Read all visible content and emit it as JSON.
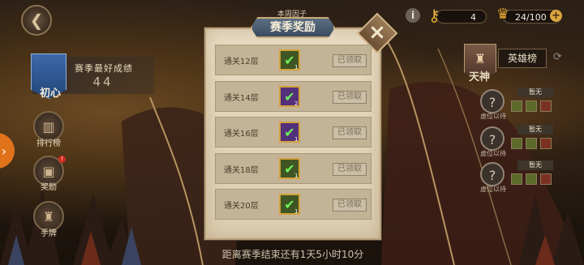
{
  "header": {
    "back_icon": "back-arrow-icon"
  },
  "best_score": {
    "rank_name": "初心",
    "label": "赛季最好成绩",
    "value": "44"
  },
  "nav": [
    {
      "label": "排行榜",
      "icon": "ranking-icon",
      "glyph": "▥"
    },
    {
      "label": "奖励",
      "icon": "reward-chest-icon",
      "glyph": "▣",
      "badge": "!"
    },
    {
      "label": "手牌",
      "icon": "card-deck-icon",
      "glyph": "♜"
    }
  ],
  "side_tab": {
    "glyph": "›"
  },
  "resources": {
    "keys": "4",
    "chests": "24/100"
  },
  "modal": {
    "caption": "本周因子",
    "title": "赛季奖励",
    "rows": [
      {
        "label": "通关12层",
        "item": "green",
        "count": "1",
        "status": "已领取"
      },
      {
        "label": "通关14层",
        "item": "purple",
        "count": "2",
        "status": "已领取"
      },
      {
        "label": "通关16层",
        "item": "purple",
        "count": "1",
        "status": "已领取"
      },
      {
        "label": "通关18层",
        "item": "green",
        "count": "1",
        "status": "已领取"
      },
      {
        "label": "通关20层",
        "item": "green",
        "count": "1",
        "status": "已领取"
      }
    ]
  },
  "right": {
    "hero_rank": "天神",
    "hero_list": "英雄榜",
    "slots": [
      {
        "tag": "暂无",
        "sub": "虚位以待"
      },
      {
        "tag": "暂无",
        "sub": "虚位以待"
      },
      {
        "tag": "暂无",
        "sub": "虚位以待"
      }
    ]
  },
  "countdown": "距离赛季结束还有1天5小时10分"
}
